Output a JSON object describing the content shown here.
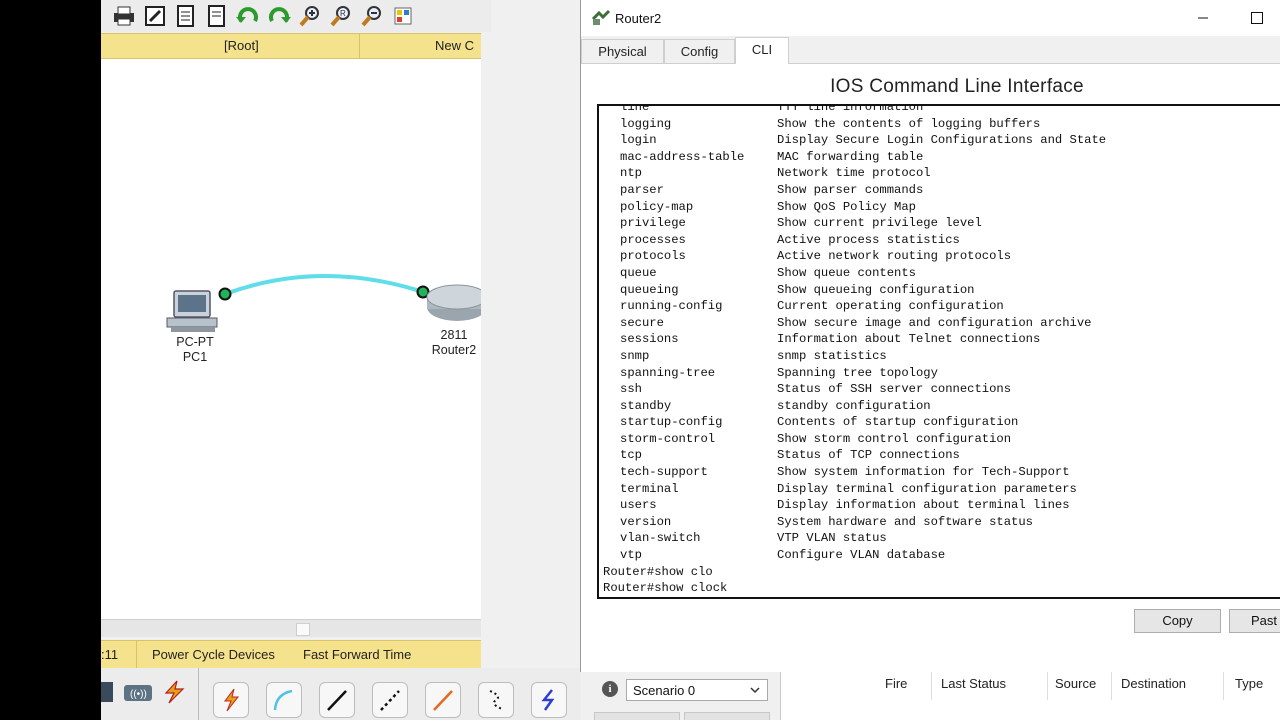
{
  "toolbar": {
    "icons": [
      "print-icon",
      "edit-icon",
      "document-icon",
      "document-icon",
      "undo-icon",
      "redo-icon",
      "zoom-in-icon",
      "zoom-reset-icon",
      "zoom-out-icon",
      "palette-icon"
    ]
  },
  "workspace_bar": {
    "root_label": "[Root]",
    "new_label": "New C"
  },
  "topology": {
    "pc": {
      "type": "PC-PT",
      "name": "PC1"
    },
    "router": {
      "type": "2811",
      "name": "Router2"
    },
    "link_color": "#5fdde8"
  },
  "realtime_bar": {
    "clock": ":11",
    "power_cycle": "Power Cycle Devices",
    "fast_forward": "Fast Forward Time"
  },
  "scenario": {
    "selected": "Scenario 0"
  },
  "pdu_table": {
    "columns": [
      "Fire",
      "Last Status",
      "Source",
      "Destination",
      "Type"
    ]
  },
  "dialog": {
    "title": "Router2",
    "tabs": [
      "Physical",
      "Config",
      "CLI"
    ],
    "active_tab": "CLI",
    "heading": "IOS Command Line Interface",
    "cli_rows": [
      {
        "cmd": "line",
        "desc": "TTY line information"
      },
      {
        "cmd": "logging",
        "desc": "Show the contents of logging buffers"
      },
      {
        "cmd": "login",
        "desc": "Display Secure Login Configurations and State"
      },
      {
        "cmd": "mac-address-table",
        "desc": "MAC forwarding table"
      },
      {
        "cmd": "ntp",
        "desc": "Network time protocol"
      },
      {
        "cmd": "parser",
        "desc": "Show parser commands"
      },
      {
        "cmd": "policy-map",
        "desc": "Show QoS Policy Map"
      },
      {
        "cmd": "privilege",
        "desc": "Show current privilege level"
      },
      {
        "cmd": "processes",
        "desc": "Active process statistics"
      },
      {
        "cmd": "protocols",
        "desc": "Active network routing protocols"
      },
      {
        "cmd": "queue",
        "desc": "Show queue contents"
      },
      {
        "cmd": "queueing",
        "desc": "Show queueing configuration"
      },
      {
        "cmd": "running-config",
        "desc": "Current operating configuration"
      },
      {
        "cmd": "secure",
        "desc": "Show secure image and configuration archive"
      },
      {
        "cmd": "sessions",
        "desc": "Information about Telnet connections"
      },
      {
        "cmd": "snmp",
        "desc": "snmp statistics"
      },
      {
        "cmd": "spanning-tree",
        "desc": "Spanning tree topology"
      },
      {
        "cmd": "ssh",
        "desc": "Status of SSH server connections"
      },
      {
        "cmd": "standby",
        "desc": "standby configuration"
      },
      {
        "cmd": "startup-config",
        "desc": "Contents of startup configuration"
      },
      {
        "cmd": "storm-control",
        "desc": "Show storm control configuration"
      },
      {
        "cmd": "tcp",
        "desc": "Status of TCP connections"
      },
      {
        "cmd": "tech-support",
        "desc": "Show system information for Tech-Support"
      },
      {
        "cmd": "terminal",
        "desc": "Display terminal configuration parameters"
      },
      {
        "cmd": "users",
        "desc": "Display information about terminal lines"
      },
      {
        "cmd": "version",
        "desc": "System hardware and software status"
      },
      {
        "cmd": "vlan-switch",
        "desc": "VTP VLAN status"
      },
      {
        "cmd": "vtp",
        "desc": "Configure VLAN database"
      }
    ],
    "prompts": [
      "Router#show clo",
      "Router#show clock"
    ],
    "copy_label": "Copy",
    "paste_label": "Past"
  }
}
